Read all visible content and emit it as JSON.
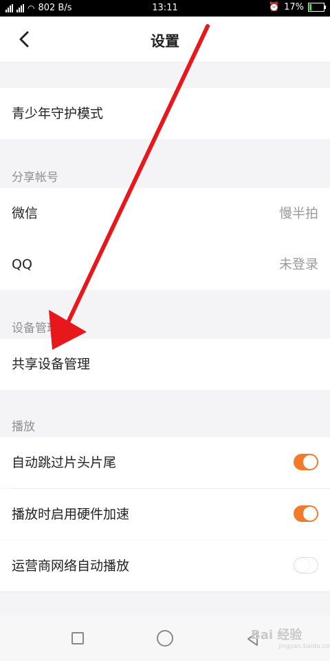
{
  "status_bar": {
    "network_speed": "802 B/s",
    "time": "13:11",
    "battery": "17%",
    "battery_level": 0.17,
    "signal_label": "4G"
  },
  "header": {
    "title": "设置",
    "back_icon": "chevron-left-icon"
  },
  "items": {
    "youth_mode": "青少年守护模式",
    "wechat": {
      "label": "微信",
      "value": "慢半拍"
    },
    "qq": {
      "label": "QQ",
      "value": "未登录"
    },
    "shared_device": "共享设备管理",
    "skip_intro": "自动跳过片头片尾",
    "hw_accel": "播放时启用硬件加速",
    "carrier_autoplay": "运营商网络自动播放"
  },
  "sections": {
    "share_account": "分享帐号",
    "device_manage": "设备管理",
    "playback": "播放"
  },
  "toggles": {
    "skip_intro": true,
    "hw_accel": true,
    "carrier_autoplay": false
  },
  "colors": {
    "accent": "#f07b2a",
    "arrow": "#e8171b"
  },
  "watermark": {
    "text": "Bai 经验",
    "sub": "jingyan.baidu.com"
  }
}
